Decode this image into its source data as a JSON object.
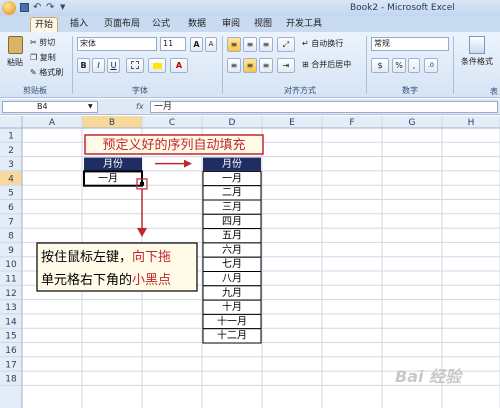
{
  "window_title": "Book2 - Microsoft Excel",
  "tabs": [
    "开始",
    "插入",
    "页面布局",
    "公式",
    "数据",
    "审阅",
    "视图",
    "开发工具"
  ],
  "ribbon": {
    "clipboard": {
      "paste": "粘贴",
      "cut": "剪切",
      "copy": "复制",
      "format_painter": "格式刷",
      "label": "剪贴板"
    },
    "font": {
      "font_name": "宋体",
      "font_size": "11",
      "bold": "B",
      "italic": "I",
      "underline": "U",
      "label": "字体",
      "grow": "A",
      "shrink": "A",
      "color_glyph": "A"
    },
    "alignment": {
      "wrap_text": "自动换行",
      "merge_center": "合并后居中",
      "label": "对齐方式"
    },
    "number": {
      "format": "常规",
      "percent": "%",
      "comma": ",",
      "label": "数字",
      "currency": "$"
    },
    "styles": {
      "conditional_format": "条件格式",
      "more": "表"
    }
  },
  "formula_bar": {
    "name_box": "B4",
    "fx": "fx",
    "content": "一月"
  },
  "columns": [
    "A",
    "B",
    "C",
    "D",
    "E",
    "F",
    "G",
    "H"
  ],
  "rows": [
    "1",
    "2",
    "3",
    "4",
    "5",
    "6",
    "7",
    "8",
    "9",
    "10",
    "11",
    "12",
    "13",
    "14",
    "15",
    "16",
    "17",
    "18"
  ],
  "cells": {
    "b3": "月份",
    "b4": "一月",
    "d3": "月份",
    "d_months": [
      "一月",
      "二月",
      "三月",
      "四月",
      "五月",
      "六月",
      "七月",
      "八月",
      "九月",
      "十月",
      "十一月",
      "十二月"
    ]
  },
  "annotations": {
    "title": "预定义好的序列自动填充",
    "instruction_line1_prefix": "按住鼠标左键，",
    "instruction_line1_highlight": "向下拖",
    "instruction_line2_prefix": "单元格右下角的",
    "instruction_line2_highlight": "小黑点"
  },
  "watermark": "Bai 经验",
  "colors": {
    "header_fill": "#1f2e62",
    "header_text": "#ffffff",
    "accent_red": "#c0272d",
    "callout_fill": "#fffbe8"
  }
}
